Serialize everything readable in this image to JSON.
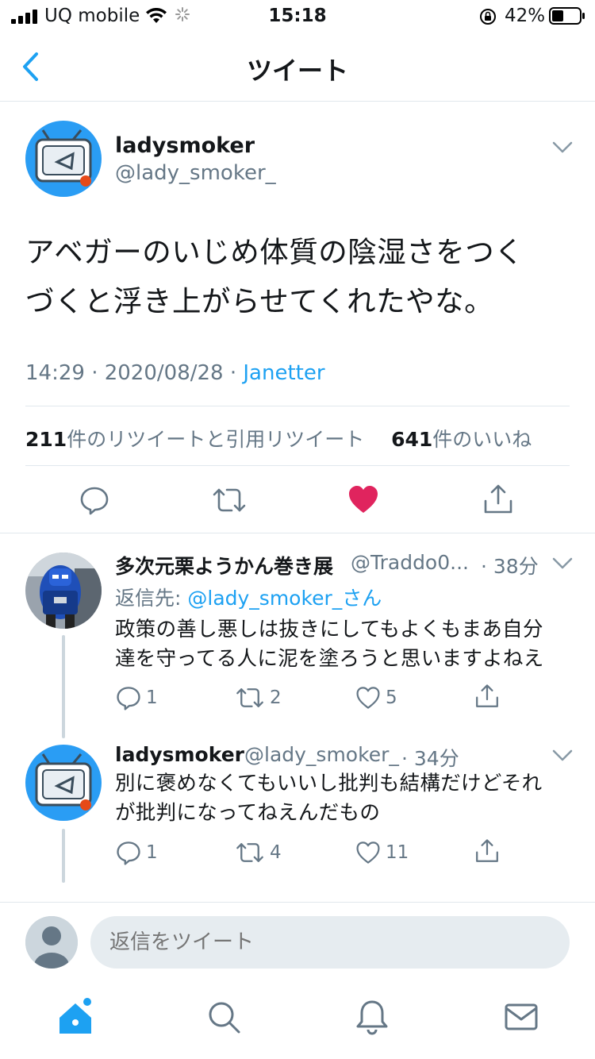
{
  "status_bar": {
    "carrier": "UQ mobile",
    "time": "15:18",
    "battery_percent": "42%",
    "battery_level": 0.42
  },
  "header": {
    "title": "ツイート",
    "back_icon": "chevron-left-icon"
  },
  "main_tweet": {
    "display_name": "ladysmoker",
    "handle": "@lady_smoker_",
    "text_line1": "アベガーのいじめ体質の陰湿さをつく",
    "text_line2": "づくと浮き上がらせてくれたやな。",
    "timestamp": "14:29 · 2020/08/28 · ",
    "source": "Janetter",
    "retweet_count": "211",
    "retweet_label": "件のリツイートと引用リツイート",
    "like_count": "641",
    "like_label": "件のいいね",
    "liked": true,
    "accent_color": "#1da1f2",
    "like_color": "#e0245e"
  },
  "replies": [
    {
      "display_name": "多次元栗ようかん巻き展",
      "handle": "@Traddo0...",
      "time": "· 38分",
      "reply_to_prefix": "返信先: ",
      "reply_to_user": "@lady_smoker_さん",
      "text_line1": "政策の善し悪しは抜きにしてもよくもまあ自分",
      "text_line2": "達を守ってる人に泥を塗ろうと思いますよねえ",
      "reply_count": "1",
      "retweet_count": "2",
      "like_count": "5"
    },
    {
      "display_name": "ladysmoker",
      "handle": "@lady_smoker_",
      "time": "· 34分",
      "text_line1": "別に褒めなくてもいいし批判も結構だけどそれ",
      "text_line2": "が批判になってねえんだもの",
      "reply_count": "1",
      "retweet_count": "4",
      "like_count": "11"
    }
  ],
  "composer": {
    "placeholder": "返信をツイート"
  },
  "tab_bar": {
    "items": [
      "home-icon",
      "search-icon",
      "notifications-icon",
      "messages-icon"
    ],
    "active": "home-icon"
  }
}
